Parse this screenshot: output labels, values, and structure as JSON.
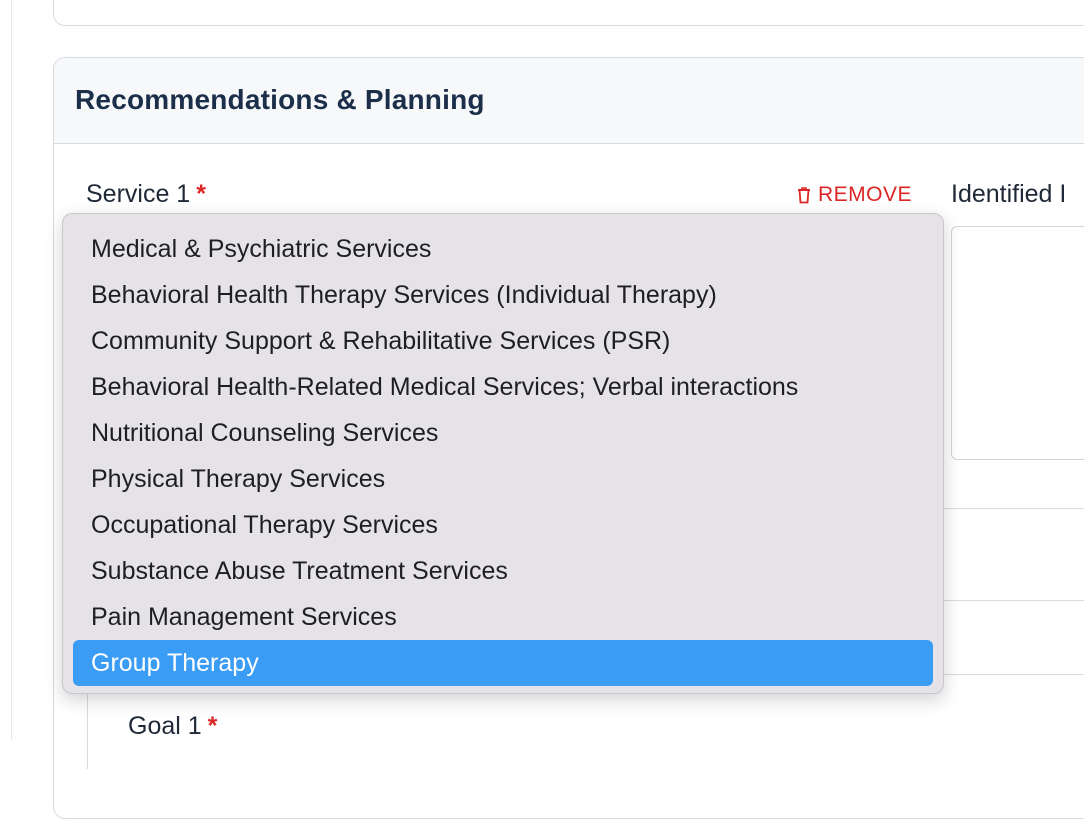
{
  "section": {
    "title": "Recommendations & Planning"
  },
  "service": {
    "label": "Service 1",
    "required_mark": "*",
    "remove_label": "REMOVE",
    "selected_value": "Group Therapy",
    "options": [
      "Medical & Psychiatric Services",
      "Behavioral Health Therapy Services (Individual Therapy)",
      "Community Support & Rehabilitative Services (PSR)",
      "Behavioral Health-Related Medical Services; Verbal interactions",
      "Nutritional Counseling Services",
      "Physical Therapy Services",
      "Occupational Therapy Services",
      "Substance Abuse Treatment Services",
      "Pain Management Services",
      "Group Therapy"
    ]
  },
  "identified": {
    "label": "Identified I"
  },
  "goal": {
    "label": "Goal 1",
    "required_mark": "*"
  },
  "colors": {
    "accent": "#3b9cf5",
    "danger": "#dc2626",
    "title": "#1c2f4a"
  }
}
